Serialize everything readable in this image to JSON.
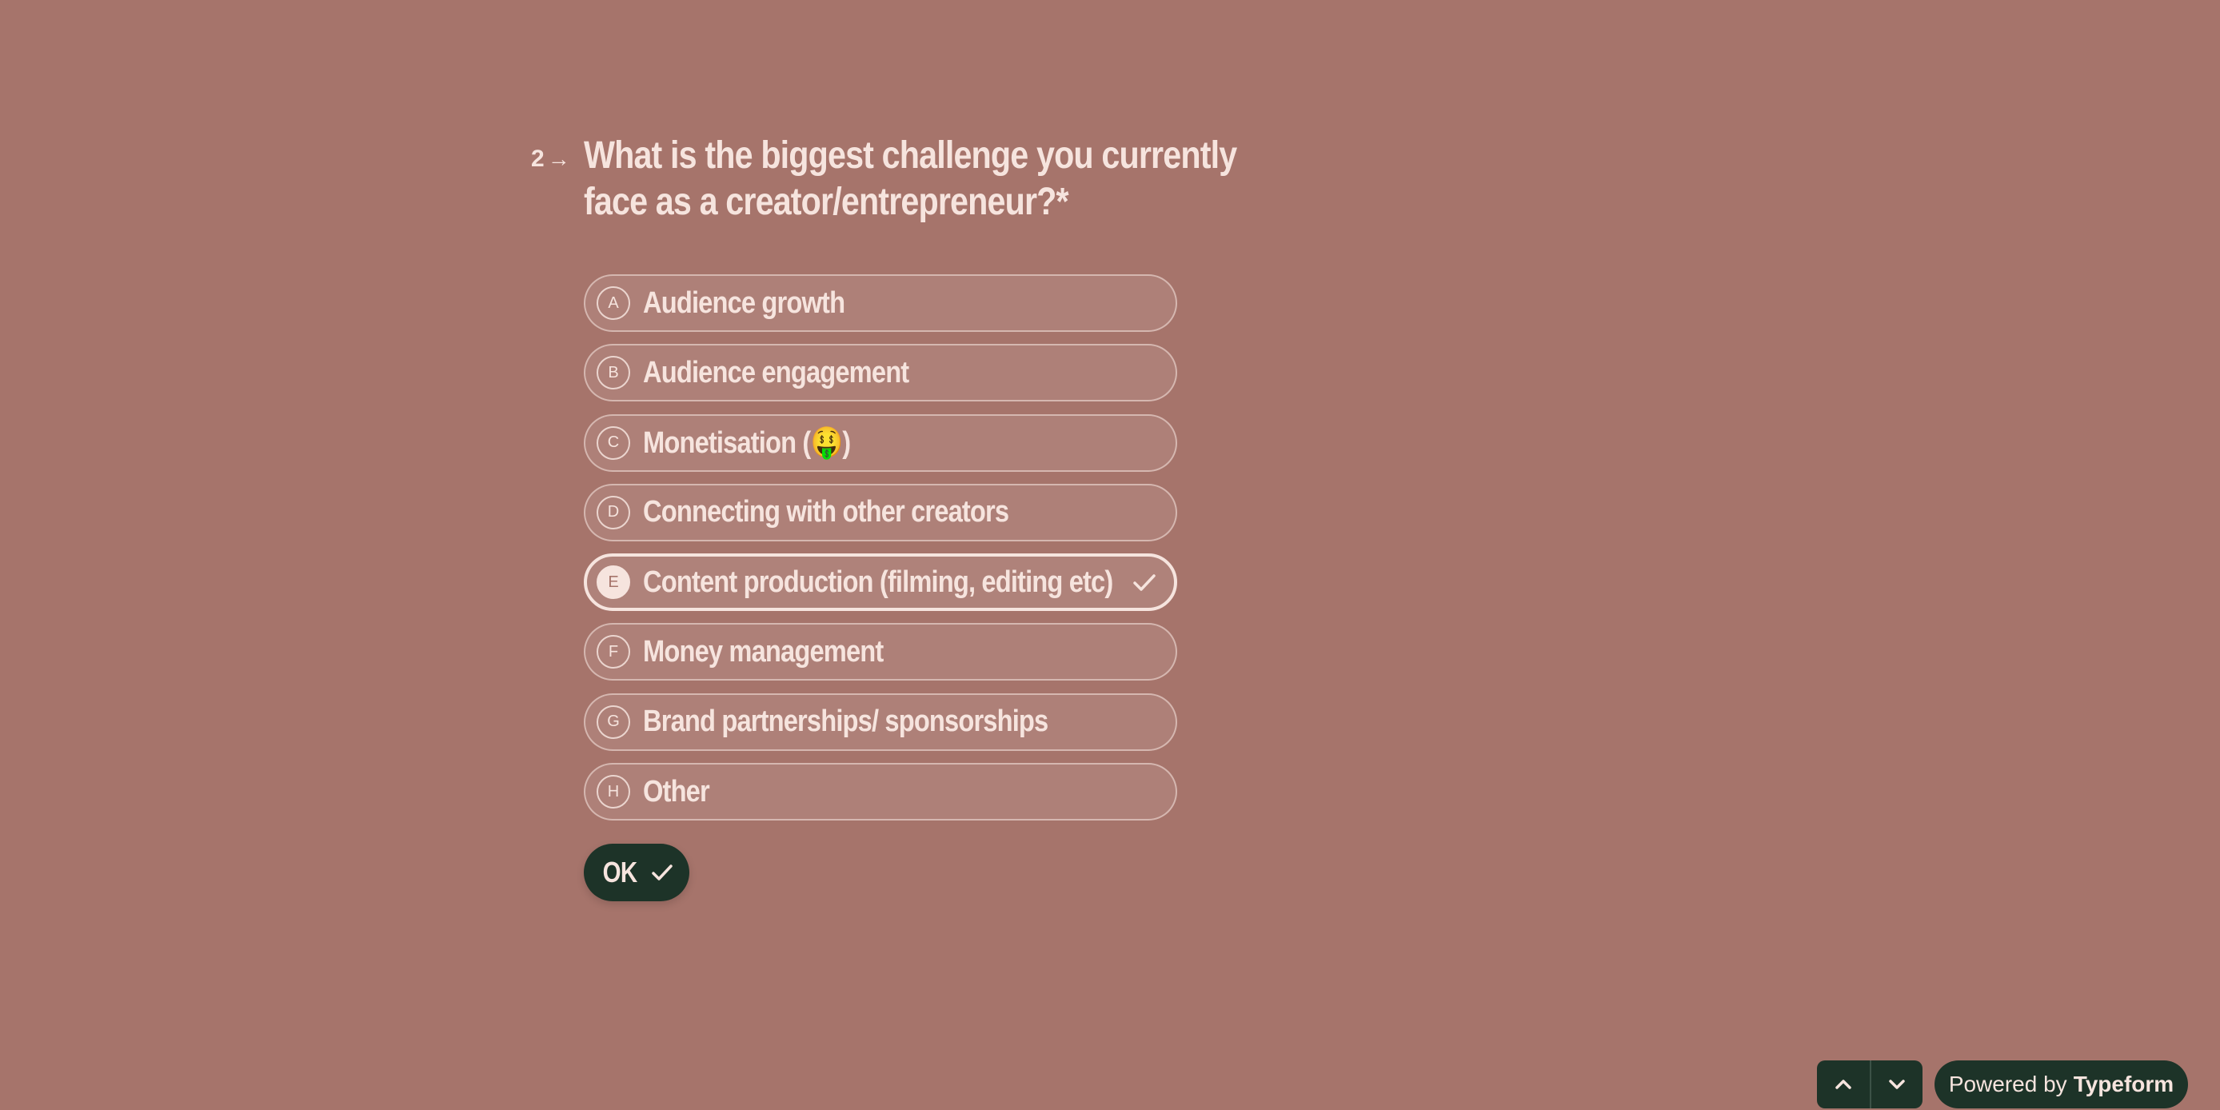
{
  "question": {
    "number": "2",
    "arrow": "→",
    "title": "What is the biggest challenge you currently face as a creator/entrepreneur?",
    "required_marker": "*"
  },
  "options": [
    {
      "key": "A",
      "label": "Audience growth",
      "selected": false
    },
    {
      "key": "B",
      "label": "Audience engagement",
      "selected": false
    },
    {
      "key": "C",
      "label": "Monetisation (🤑)",
      "selected": false
    },
    {
      "key": "D",
      "label": "Connecting with other creators",
      "selected": false
    },
    {
      "key": "E",
      "label": "Content production (filming, editing etc)",
      "selected": true
    },
    {
      "key": "F",
      "label": "Money management",
      "selected": false
    },
    {
      "key": "G",
      "label": "Brand partnerships/ sponsorships",
      "selected": false
    },
    {
      "key": "H",
      "label": "Other",
      "selected": false
    }
  ],
  "ok_button": {
    "label": "OK",
    "icon": "check-icon"
  },
  "navigation": {
    "up_icon": "chevron-up-icon",
    "down_icon": "chevron-down-icon"
  },
  "powered_by": {
    "prefix": "Powered by",
    "brand": "Typeform"
  },
  "colors": {
    "background": "#a6746b",
    "text": "#f6e4de",
    "button": "#1d3328"
  }
}
